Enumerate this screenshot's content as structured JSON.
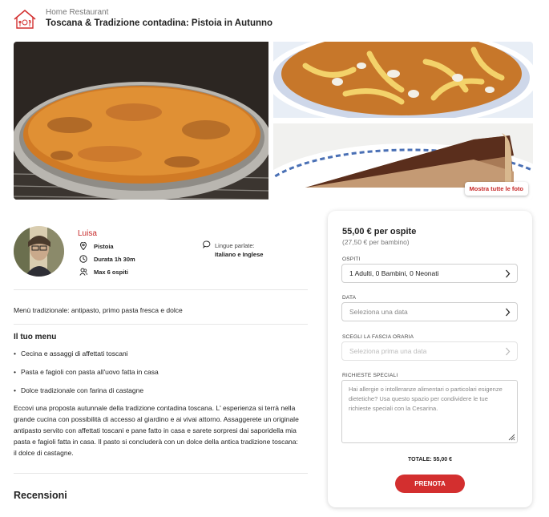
{
  "header": {
    "breadcrumb": "Home Restaurant",
    "title": "Toscana & Tradizione contadina: Pistoia in Autunno",
    "logo_icon": "home-restaurant-logo-icon"
  },
  "gallery": {
    "show_all_label": "Mostra tutte le foto",
    "photos": [
      "cecina-photo",
      "pasta-e-fagioli-photo",
      "chestnut-cake-photo"
    ]
  },
  "host": {
    "name": "Luisa",
    "location": "Pistoia",
    "duration": "Durata 1h 30m",
    "max_guests": "Max 6 ospiti",
    "languages_label": "Lingue parlate:",
    "languages_value": "Italiano e Inglese"
  },
  "summary": "Menù tradizionale: antipasto, primo pasta fresca e dolce",
  "menu": {
    "title": "Il tuo menu",
    "items": [
      "Cecina e assaggi di affettati toscani",
      "Pasta e fagioli con pasta all'uovo fatta in casa",
      "Dolce tradizionale con farina di castagne"
    ]
  },
  "description": "Eccovi una proposta autunnale della tradizione contadina toscana. L' esperienza si terrà nella grande cucina con possibilità di accesso al giardino e ai vivai attorno. Assaggerete un originale antipasto servito con affettati toscani e pane fatto in casa e sarete sorpresi dai saporidella mia pasta e fagioli fatta in casa. Il pasto si concluderà con un dolce della antica tradizione toscana: il dolce di castagne.",
  "reviews_title": "Recensioni",
  "booking": {
    "price": "55,00 € per ospite",
    "price_child": "(27,50 € per bambino)",
    "guests_label": "OSPITI",
    "guests_value": "1 Adulti, 0 Bambini, 0 Neonati",
    "date_label": "DATA",
    "date_placeholder": "Seleziona una data",
    "time_label": "SCEGLI LA FASCIA ORARIA",
    "time_placeholder": "Seleziona prima una data",
    "requests_label": "RICHIESTE SPECIALI",
    "requests_placeholder": "Hai allergie o intolleranze alimentari o particolari esigenze dietetiche? Usa questo spazio per condividere le tue richieste speciali con la Cesarina.",
    "total": "TOTALE: 55,00 €",
    "book_button": "PRENOTA"
  },
  "colors": {
    "accent": "#d32f2f",
    "host_name": "#c62828"
  }
}
